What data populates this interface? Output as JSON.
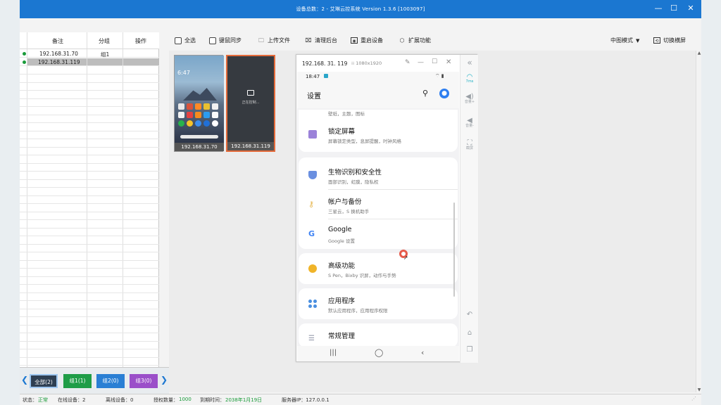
{
  "window": {
    "title": "设备总数：2 - 艾琳云控系统 Version 1.3.6 [1003097]",
    "controls": [
      "minimize-icon",
      "maximize-icon",
      "close-icon"
    ]
  },
  "device_table": {
    "headers": [
      "备注",
      "分组",
      "操作"
    ],
    "rows": [
      {
        "ip": "192.168.31.70",
        "group": "组1",
        "online": true,
        "selected": false
      },
      {
        "ip": "192.168.31.119",
        "group": "",
        "online": true,
        "selected": true
      }
    ]
  },
  "groups": {
    "buttons": [
      {
        "label": "全部(2)",
        "color": "#2e3f52",
        "active": true
      },
      {
        "label": "组1(1)",
        "color": "#1f9d47",
        "active": false
      },
      {
        "label": "组2(0)",
        "color": "#2a7fd4",
        "active": false
      },
      {
        "label": "组3(0)",
        "color": "#9b4fc9",
        "active": false
      }
    ]
  },
  "toolbar": {
    "select_all": "全选",
    "mouse_sync": "键鼠同步",
    "upload_file": "上传文件",
    "clear_background": "清理后台",
    "restart_device": "重启设备",
    "extensions": "扩展功能",
    "view_mode": "中图模式",
    "switch_orientation": "切换横屏"
  },
  "thumbnails": [
    {
      "label": "192.168.31.70",
      "state": "home",
      "time": "6:47"
    },
    {
      "label": "192.168.31.119",
      "state": "controlling",
      "status_text": "正在控制..."
    }
  ],
  "phone_window": {
    "ip": "192.168. 31. 119",
    "resolution": "1080x1920",
    "status_time": "18:47",
    "screen_title": "设置",
    "partial_item_subtitle": "壁纸，主题，图标",
    "items": [
      {
        "title": "锁定屏幕",
        "subtitle": "屏幕锁定类型，息屏提醒，时钟风格",
        "icon": "lock-icon",
        "color": "#9b82d9"
      },
      {
        "title": "生物识别和安全性",
        "subtitle": "面部识别，虹膜，隐私权",
        "icon": "shield-icon",
        "color": "#6a8fe0"
      },
      {
        "title": "帐户与备份",
        "subtitle": "三星云，S 换机助手",
        "icon": "key-icon",
        "color": "#e6b44a"
      },
      {
        "title": "Google",
        "subtitle": "Google 设置",
        "icon": "google-icon",
        "color": "#4285f4"
      },
      {
        "title": "高级功能",
        "subtitle": "S Pen，Bixby 识屏，动作与手势",
        "icon": "gear-plus-icon",
        "color": "#f0b429"
      },
      {
        "title": "应用程序",
        "subtitle": "默认应用程序，应用程序权限",
        "icon": "apps-icon",
        "color": "#4a8fe0"
      },
      {
        "title": "常规管理",
        "subtitle": "",
        "icon": "sliders-icon",
        "color": "#8a8fa3"
      }
    ],
    "side_tools": [
      {
        "icon": "wifi-icon",
        "label": "7ms"
      },
      {
        "icon": "volume-up-icon",
        "label": "音量+"
      },
      {
        "icon": "volume-down-icon",
        "label": "音量-"
      },
      {
        "icon": "screenshot-icon",
        "label": "截屏"
      }
    ]
  },
  "statusbar": {
    "status_label": "状态：",
    "status_value": "正常",
    "online_devices": "在线设备：2",
    "offline_devices": "离线设备：0",
    "auth_label": "授权数量：",
    "auth_value": "1000",
    "expire_label": "到期时间：",
    "expire_value": "2038年1月19日",
    "server_ip": "服务器IP：127.0.0.1",
    "status_color": "#1a9b3a"
  }
}
